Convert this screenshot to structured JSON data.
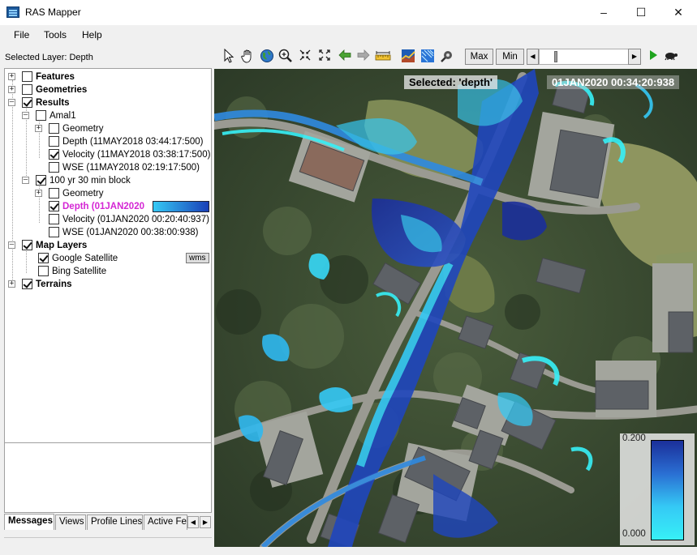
{
  "window": {
    "title": "RAS Mapper"
  },
  "menu": [
    "File",
    "Tools",
    "Help"
  ],
  "selected_layer_label": "Selected Layer: Depth",
  "tree": {
    "features": "Features",
    "geometries": "Geometries",
    "results": "Results",
    "amal1": {
      "name": "Amal1",
      "geometry": "Geometry",
      "depth": "Depth (11MAY2018 03:44:17:500)",
      "velocity": "Velocity (11MAY2018 03:38:17:500)",
      "wse": "WSE (11MAY2018 02:19:17:500)"
    },
    "block": {
      "name": "100 yr 30 min block",
      "geometry": "Geometry",
      "depth": "Depth (01JAN2020",
      "velocity": "Velocity (01JAN2020 00:20:40:937)",
      "wse": "WSE (01JAN2020 00:38:00:938)"
    },
    "map_layers": "Map Layers",
    "google": "Google Satellite",
    "google_badge": "wms",
    "bing": "Bing Satellite",
    "terrains": "Terrains"
  },
  "bottom_tabs": [
    "Messages",
    "Views",
    "Profile Lines",
    "Active Fe"
  ],
  "toolbar": {
    "max_label": "Max",
    "min_label": "Min"
  },
  "map": {
    "selected_label": "Selected: 'depth'",
    "time_label": "01JAN2020 00:34:20:938",
    "legend_max": "0.200",
    "legend_min": "0.000"
  },
  "colors": {
    "selected_layer": "#d426d4",
    "depth_shallow": "#37f0f7",
    "depth_deep": "#1b2f9a"
  }
}
